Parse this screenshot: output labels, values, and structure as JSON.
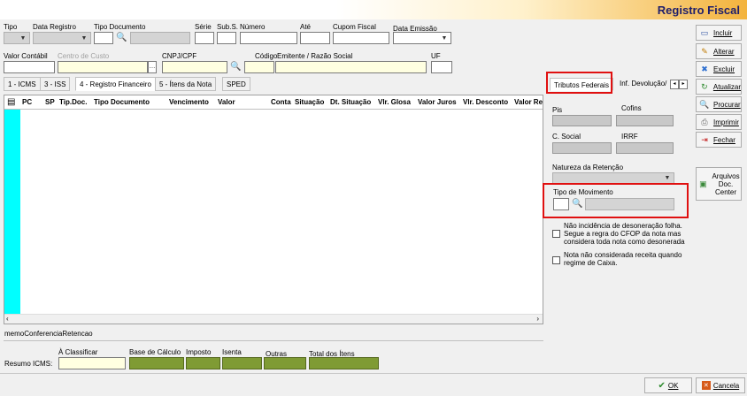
{
  "header": {
    "title": "Registro Fiscal"
  },
  "top_row_labels": {
    "tipo": "Tipo",
    "data_registro": "Data Registro",
    "tipo_documento": "Tipo Documento",
    "serie": "Série",
    "sub_s": "Sub.S.",
    "numero": "Número",
    "ate": "Até",
    "cupom_fiscal": "Cupom Fiscal",
    "data_emissao": "Data Emissão"
  },
  "second_row_labels": {
    "valor_contabil": "Valor Contábil",
    "centro_custo": "Centro de Custo",
    "cnpj_cpf": "CNPJ/CPF",
    "codigo": "Código",
    "emitente": "Emitente / Razão Social",
    "uf": "UF"
  },
  "tabs": [
    "1 - ICMS",
    "3 - ISS",
    "4 - Registro Financeiro",
    "5 - Ítens da Nota",
    "SPED"
  ],
  "grid_columns": [
    "PC",
    "SP",
    "Tip.Doc.",
    "Tipo Documento",
    "Vencimento",
    "Valor",
    "Conta",
    "Situação",
    "Dt. Situação",
    "Vlr. Glosa",
    "Valor Juros",
    "Vlr. Desconto",
    "Valor Re"
  ],
  "memo_label": "memoConferenciaRetencao",
  "right_tabs": {
    "tributos": "Tributos Federais",
    "inf_devolucao": "Inf. Devolução/"
  },
  "tributos": {
    "pis": "Pis",
    "cofins": "Cofins",
    "c_social": "C. Social",
    "irrf": "IRRF",
    "natureza": "Natureza da Retenção",
    "tipo_movimento": "Tipo  de Movimento"
  },
  "checkboxes": [
    "Não incidência de desoneração folha. Segue a regra do CFOP da nota mas considera toda nota como desonerada",
    "Nota não considerada receita quando regime de Caixa."
  ],
  "checkbox_lines": [
    [
      "Não incidência de desoneração folha.",
      "Segue a regra do CFOP da nota mas",
      "considera toda nota como desonerada"
    ],
    [
      "Nota não considerada receita quando",
      "regime de Caixa."
    ]
  ],
  "side_buttons": [
    "Incluir",
    "Alterar",
    "Excluir",
    "Atualizar",
    "Procurar",
    "Imprimir",
    "Fechar"
  ],
  "arquivos_button": [
    "Arquivos",
    "Doc.",
    "Center"
  ],
  "summary": {
    "label": "Resumo ICMS:",
    "a_classificar": "À Classificar",
    "base_calculo": "Base de Cálculo",
    "imposto": "Imposto",
    "isenta": "Isenta",
    "outras": "Outras",
    "total": "Total dos Ítens"
  },
  "bottom_buttons": {
    "ok": "OK",
    "cancela": "Cancela"
  },
  "colors": {
    "accent_red": "#e01010",
    "cyan": "#00ffff",
    "summary_green": "#7f9b34",
    "field_yellow": "#ffffe1"
  }
}
